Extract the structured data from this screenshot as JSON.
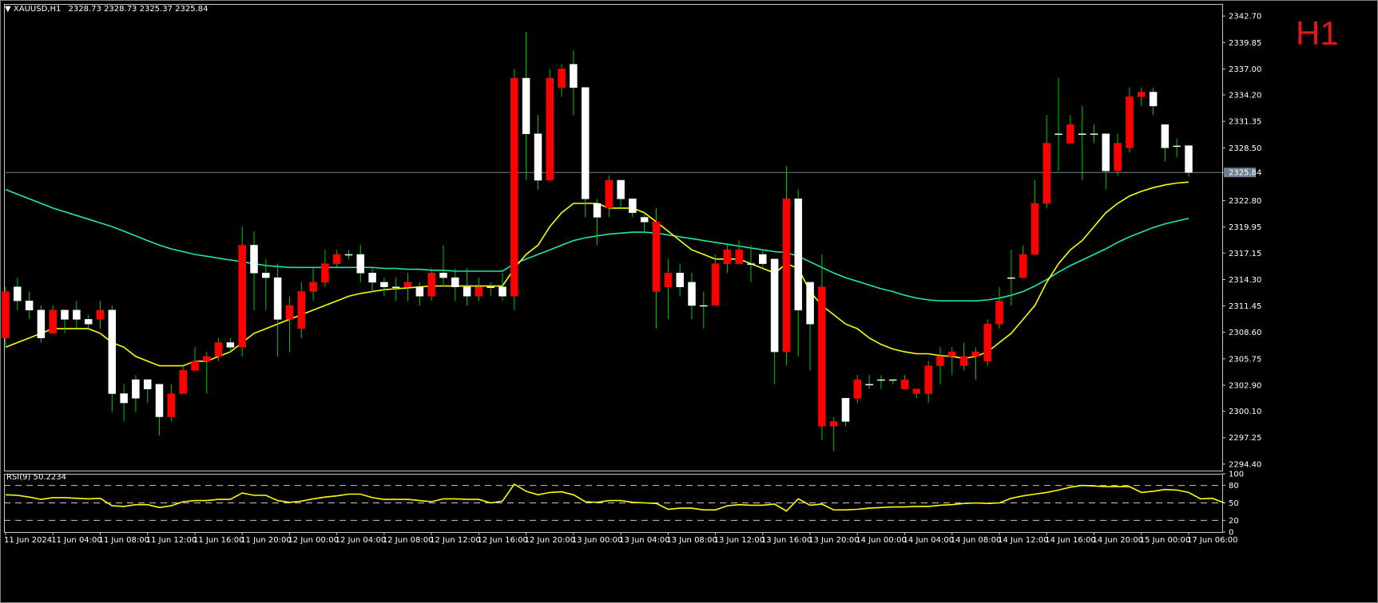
{
  "header": {
    "symbol": "XAUUSD,H1",
    "ohlc": "2328.73 2328.73 2325.37 2325.84",
    "timeframe_badge": "H1"
  },
  "rsi": {
    "label": "RSI(9) 50.2234",
    "levels": [
      80,
      50,
      20
    ]
  },
  "colors": {
    "bull": "#ffffff",
    "bear": "#ff0000",
    "wick": "#00c800",
    "ma_fast": "#ffff00",
    "ma_slow": "#1ee6b4",
    "rsi": "#ffff00",
    "grid_line": "#708090"
  },
  "chart_data": [
    {
      "type": "candlestick",
      "title": "XAUUSD,H1",
      "ylim": [
        2293.7,
        2344.0
      ],
      "yticks": [
        "2342.70",
        "2339.85",
        "2337.00",
        "2334.20",
        "2331.35",
        "2328.50",
        "2325.84",
        "2322.80",
        "2319.95",
        "2317.15",
        "2314.30",
        "2311.45",
        "2308.60",
        "2305.75",
        "2302.90",
        "2300.10",
        "2297.25",
        "2294.40"
      ],
      "current_price": "2325.84",
      "xticks": [
        "11 Jun 2024",
        "11 Jun 04:00",
        "11 Jun 08:00",
        "11 Jun 12:00",
        "11 Jun 16:00",
        "11 Jun 20:00",
        "12 Jun 00:00",
        "12 Jun 04:00",
        "12 Jun 08:00",
        "12 Jun 12:00",
        "12 Jun 16:00",
        "12 Jun 20:00",
        "13 Jun 00:00",
        "13 Jun 04:00",
        "13 Jun 08:00",
        "13 Jun 12:00",
        "13 Jun 16:00",
        "13 Jun 20:00",
        "14 Jun 00:00",
        "14 Jun 04:00",
        "14 Jun 08:00",
        "14 Jun 12:00",
        "14 Jun 16:00",
        "14 Jun 20:00",
        "15 Jun 00:00",
        "17 Jun 06:00"
      ],
      "candles": [
        [
          2313.0,
          2313.5,
          2307.0,
          2308.0
        ],
        [
          2312.0,
          2314.5,
          2311.0,
          2313.5
        ],
        [
          2311.0,
          2313.0,
          2310.0,
          2312.0
        ],
        [
          2308.0,
          2311.5,
          2307.5,
          2311.0
        ],
        [
          2311.0,
          2311.5,
          2308.5,
          2308.5
        ],
        [
          2310.0,
          2311.0,
          2308.5,
          2311.0
        ],
        [
          2310.0,
          2312.0,
          2309.0,
          2311.0
        ],
        [
          2309.5,
          2310.5,
          2309.0,
          2310.0
        ],
        [
          2311.0,
          2312.0,
          2309.0,
          2310.0
        ],
        [
          2302.0,
          2311.5,
          2300.0,
          2311.0
        ],
        [
          2301.0,
          2303.0,
          2299.0,
          2302.0
        ],
        [
          2301.5,
          2304.0,
          2300.0,
          2303.5
        ],
        [
          2302.5,
          2303.5,
          2301.0,
          2303.5
        ],
        [
          2299.5,
          2303.0,
          2297.5,
          2303.0
        ],
        [
          2302.0,
          2303.0,
          2299.0,
          2299.5
        ],
        [
          2304.5,
          2305.0,
          2302.0,
          2302.0
        ],
        [
          2305.5,
          2307.0,
          2304.5,
          2304.5
        ],
        [
          2306.0,
          2306.5,
          2302.0,
          2305.5
        ],
        [
          2307.5,
          2308.0,
          2305.5,
          2306.0
        ],
        [
          2307.0,
          2308.0,
          2306.5,
          2307.5
        ],
        [
          2318.0,
          2320.0,
          2306.0,
          2307.0
        ],
        [
          2315.0,
          2319.5,
          2311.0,
          2318.0
        ],
        [
          2314.5,
          2316.5,
          2311.0,
          2315.0
        ],
        [
          2310.0,
          2316.0,
          2306.0,
          2314.5
        ],
        [
          2311.5,
          2312.5,
          2306.5,
          2310.0
        ],
        [
          2313.0,
          2314.0,
          2308.0,
          2309.0
        ],
        [
          2314.0,
          2315.5,
          2312.0,
          2313.0
        ],
        [
          2316.0,
          2317.5,
          2313.5,
          2314.0
        ],
        [
          2317.0,
          2317.5,
          2315.5,
          2316.0
        ],
        [
          2317.0,
          2317.5,
          2316.5,
          2317.0
        ],
        [
          2315.0,
          2318.0,
          2314.0,
          2317.0
        ],
        [
          2314.0,
          2315.5,
          2313.0,
          2315.0
        ],
        [
          2313.5,
          2314.5,
          2312.5,
          2314.0
        ],
        [
          2313.5,
          2314.5,
          2312.0,
          2313.5
        ],
        [
          2314.0,
          2315.0,
          2312.0,
          2313.5
        ],
        [
          2312.5,
          2314.0,
          2311.5,
          2313.5
        ],
        [
          2315.0,
          2315.5,
          2312.0,
          2312.5
        ],
        [
          2314.5,
          2318.0,
          2313.5,
          2315.0
        ],
        [
          2313.5,
          2315.5,
          2312.0,
          2314.5
        ],
        [
          2312.5,
          2315.5,
          2311.5,
          2313.5
        ],
        [
          2313.5,
          2314.5,
          2312.0,
          2312.5
        ],
        [
          2313.5,
          2314.0,
          2312.5,
          2313.5
        ],
        [
          2312.5,
          2315.0,
          2312.0,
          2313.5
        ],
        [
          2336.0,
          2337.0,
          2311.0,
          2312.5
        ],
        [
          2330.0,
          2341.0,
          2325.0,
          2336.0
        ],
        [
          2325.0,
          2332.0,
          2324.0,
          2330.0
        ],
        [
          2336.0,
          2337.0,
          2325.0,
          2325.0
        ],
        [
          2337.0,
          2337.5,
          2334.0,
          2335.0
        ],
        [
          2335.0,
          2339.0,
          2332.0,
          2337.5
        ],
        [
          2323.0,
          2335.0,
          2321.0,
          2335.0
        ],
        [
          2321.0,
          2323.0,
          2318.0,
          2322.5
        ],
        [
          2325.0,
          2325.5,
          2321.0,
          2322.0
        ],
        [
          2323.0,
          2325.0,
          2322.0,
          2325.0
        ],
        [
          2321.5,
          2323.0,
          2321.0,
          2323.0
        ],
        [
          2320.5,
          2321.5,
          2319.5,
          2321.0
        ],
        [
          2320.5,
          2322.0,
          2309.0,
          2313.0
        ],
        [
          2315.0,
          2316.5,
          2310.0,
          2313.5
        ],
        [
          2313.5,
          2316.0,
          2312.5,
          2315.0
        ],
        [
          2311.5,
          2315.0,
          2310.0,
          2314.0
        ],
        [
          2311.5,
          2313.0,
          2309.0,
          2311.5
        ],
        [
          2316.0,
          2317.0,
          2311.5,
          2311.5
        ],
        [
          2317.5,
          2318.0,
          2315.0,
          2316.0
        ],
        [
          2317.5,
          2318.5,
          2316.0,
          2316.0
        ],
        [
          2316.0,
          2318.0,
          2314.0,
          2316.0
        ],
        [
          2316.0,
          2317.5,
          2315.5,
          2317.0
        ],
        [
          2306.5,
          2316.5,
          2303.0,
          2316.5
        ],
        [
          2323.0,
          2326.5,
          2305.0,
          2306.5
        ],
        [
          2311.0,
          2324.0,
          2306.0,
          2323.0
        ],
        [
          2309.5,
          2313.0,
          2304.5,
          2314.0
        ],
        [
          2313.5,
          2317.0,
          2297.0,
          2298.5
        ],
        [
          2299.0,
          2299.5,
          2295.8,
          2298.5
        ],
        [
          2299.0,
          2301.0,
          2298.5,
          2301.5
        ],
        [
          2303.5,
          2304.0,
          2301.0,
          2301.5
        ],
        [
          2303.0,
          2304.0,
          2302.5,
          2303.0
        ],
        [
          2303.5,
          2304.0,
          2302.5,
          2303.5
        ],
        [
          2303.5,
          2303.5,
          2303.0,
          2303.5
        ],
        [
          2303.5,
          2304.0,
          2302.5,
          2302.5
        ],
        [
          2302.5,
          2302.5,
          2301.5,
          2302.0
        ],
        [
          2305.0,
          2305.5,
          2301.0,
          2302.0
        ],
        [
          2306.0,
          2307.0,
          2303.0,
          2305.0
        ],
        [
          2306.5,
          2307.0,
          2304.0,
          2306.0
        ],
        [
          2306.0,
          2307.5,
          2304.5,
          2305.0
        ],
        [
          2306.5,
          2307.0,
          2303.5,
          2306.0
        ],
        [
          2309.5,
          2310.0,
          2305.0,
          2305.5
        ],
        [
          2312.0,
          2313.5,
          2309.0,
          2309.5
        ],
        [
          2314.5,
          2317.5,
          2311.5,
          2314.5
        ],
        [
          2317.0,
          2318.0,
          2314.5,
          2314.5
        ],
        [
          2322.5,
          2325.0,
          2317.0,
          2317.0
        ],
        [
          2329.0,
          2332.0,
          2322.0,
          2322.5
        ],
        [
          2330.0,
          2336.0,
          2326.0,
          2330.0
        ],
        [
          2331.0,
          2332.0,
          2329.0,
          2329.0
        ],
        [
          2330.0,
          2333.0,
          2325.0,
          2330.0
        ],
        [
          2330.0,
          2331.0,
          2329.0,
          2330.0
        ],
        [
          2326.0,
          2330.0,
          2324.0,
          2330.0
        ],
        [
          2329.0,
          2330.0,
          2325.5,
          2326.0
        ],
        [
          2334.0,
          2335.0,
          2328.0,
          2328.5
        ],
        [
          2334.5,
          2335.0,
          2333.0,
          2334.0
        ],
        [
          2333.0,
          2335.0,
          2332.0,
          2334.5
        ],
        [
          2328.5,
          2331.0,
          2327.0,
          2331.0
        ],
        [
          2328.7,
          2329.5,
          2327.5,
          2328.7
        ],
        [
          2325.84,
          2328.73,
          2325.37,
          2328.73
        ]
      ],
      "ma_fast_values": [
        2307,
        2307.5,
        2308,
        2308.5,
        2309,
        2309,
        2309,
        2309,
        2308.5,
        2307.5,
        2307,
        2306,
        2305.5,
        2305,
        2305,
        2305,
        2305.5,
        2305.5,
        2306,
        2306.5,
        2307.5,
        2308.5,
        2309,
        2309.5,
        2310,
        2310.5,
        2311,
        2311.5,
        2312,
        2312.5,
        2312.8,
        2313,
        2313.2,
        2313.3,
        2313.4,
        2313.5,
        2313.6,
        2313.6,
        2313.6,
        2313.6,
        2313.6,
        2313.6,
        2313.6,
        2315.5,
        2317,
        2318,
        2320,
        2321.5,
        2322.5,
        2322.5,
        2322.5,
        2322,
        2322,
        2322,
        2321.5,
        2320.5,
        2319.5,
        2318.5,
        2317.5,
        2317,
        2316.5,
        2316.5,
        2316.5,
        2316,
        2315.5,
        2315,
        2316,
        2315.5,
        2313,
        2311.5,
        2310.5,
        2309.5,
        2309,
        2308,
        2307.3,
        2306.8,
        2306.5,
        2306.3,
        2306.3,
        2306.1,
        2306,
        2305.8,
        2306,
        2306.5,
        2307.5,
        2308.5,
        2310,
        2311.5,
        2314,
        2316,
        2317.5,
        2318.5,
        2320,
        2321.5,
        2322.5,
        2323.3,
        2323.8,
        2324.2,
        2324.5,
        2324.7,
        2324.8
      ],
      "ma_slow_values": [
        2324,
        2323.5,
        2323,
        2322.5,
        2322,
        2321.6,
        2321.2,
        2320.8,
        2320.4,
        2320,
        2319.5,
        2319,
        2318.5,
        2318,
        2317.6,
        2317.3,
        2317,
        2316.8,
        2316.6,
        2316.4,
        2316.2,
        2316,
        2315.8,
        2315.7,
        2315.6,
        2315.6,
        2315.6,
        2315.6,
        2315.6,
        2315.6,
        2315.6,
        2315.6,
        2315.5,
        2315.5,
        2315.4,
        2315.4,
        2315.3,
        2315.3,
        2315.2,
        2315.2,
        2315.2,
        2315.2,
        2315.2,
        2316,
        2316.5,
        2317,
        2317.5,
        2318,
        2318.5,
        2318.8,
        2319,
        2319.2,
        2319.3,
        2319.4,
        2319.4,
        2319.3,
        2319.1,
        2318.9,
        2318.7,
        2318.5,
        2318.3,
        2318.1,
        2317.9,
        2317.7,
        2317.5,
        2317.3,
        2317.2,
        2316.8,
        2316.2,
        2315.6,
        2315,
        2314.5,
        2314.1,
        2313.7,
        2313.3,
        2313,
        2312.6,
        2312.3,
        2312.1,
        2312,
        2312,
        2312,
        2312,
        2312.1,
        2312.3,
        2312.6,
        2313,
        2313.6,
        2314.3,
        2315.1,
        2315.8,
        2316.4,
        2317,
        2317.6,
        2318.3,
        2318.9,
        2319.4,
        2319.9,
        2320.3,
        2320.6,
        2320.9
      ],
      "grid": false,
      "legend": "none"
    },
    {
      "type": "line",
      "title": "RSI(9) 50.2234",
      "ylim": [
        0,
        100
      ],
      "yticks": [
        "100",
        "80",
        "50",
        "20",
        "0"
      ],
      "series": [
        {
          "values": [
            64,
            63,
            60,
            56,
            59,
            59,
            58,
            57,
            58,
            45,
            44,
            47,
            47,
            42,
            45,
            52,
            54,
            54,
            56,
            56,
            67,
            63,
            63,
            54,
            51,
            53,
            57,
            60,
            62,
            65,
            65,
            59,
            56,
            56,
            56,
            54,
            52,
            57,
            57,
            56,
            56,
            50,
            53,
            82,
            70,
            64,
            68,
            69,
            64,
            52,
            51,
            54,
            54,
            51,
            50,
            49,
            39,
            41,
            41,
            38,
            38,
            45,
            47,
            46,
            46,
            48,
            36,
            57,
            46,
            48,
            38,
            38,
            39,
            41,
            42,
            43,
            43,
            44,
            44,
            46,
            47,
            49,
            50,
            49,
            50,
            58,
            62,
            65,
            68,
            72,
            77,
            80,
            79,
            78,
            78,
            78,
            68,
            70,
            73,
            72,
            68,
            57,
            58,
            50
          ]
        }
      ],
      "grid": false,
      "legend": "none"
    }
  ]
}
